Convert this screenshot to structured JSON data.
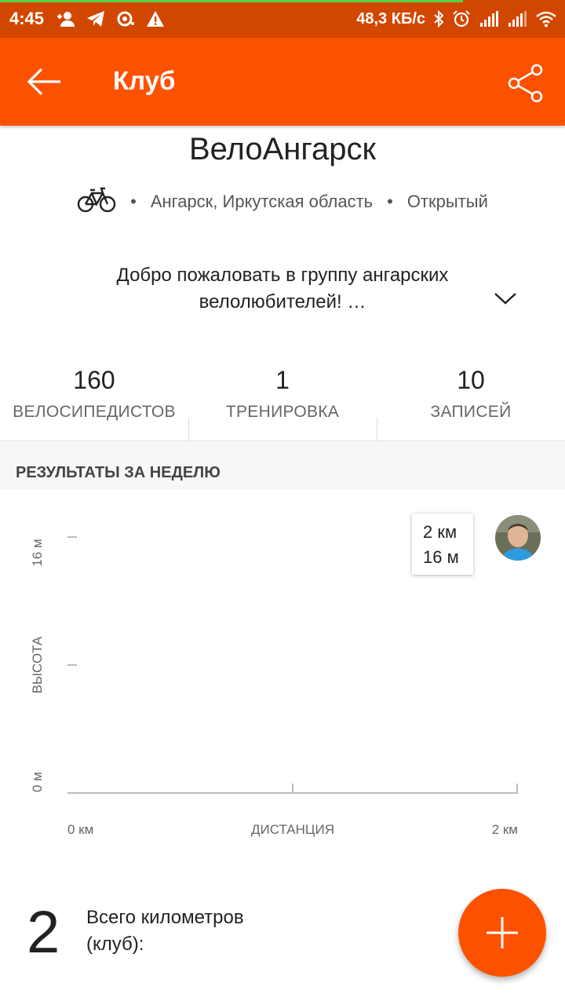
{
  "status_bar": {
    "time": "4:45",
    "network_speed": "48,3 КБ/с",
    "left_icons": [
      "add-contact-icon",
      "telegram-icon",
      "sync-icon",
      "warning-icon"
    ],
    "right_icons": [
      "bluetooth-icon",
      "alarm-icon",
      "signal-icon",
      "signal-icon",
      "wifi-icon"
    ]
  },
  "app_bar": {
    "title": "Клуб",
    "back_icon": "arrow-left-icon",
    "share_icon": "share-icon",
    "color": "#fc5200"
  },
  "club": {
    "name": "ВелоАнгарск",
    "sport_icon": "bicycle-icon",
    "location": "Ангарск, Иркутская область",
    "privacy": "Открытый",
    "description_line1": "Добро пожаловать в группу ангарских",
    "description_line2": "велолюбителей!  …"
  },
  "stats": [
    {
      "value": "160",
      "label": "ВЕЛОСИПЕДИСТОВ"
    },
    {
      "value": "1",
      "label": "ТРЕНИРОВКА"
    },
    {
      "value": "10",
      "label": "ЗАПИСЕЙ"
    }
  ],
  "weekly": {
    "title": "РЕЗУЛЬТАТЫ ЗА НЕДЕЛЮ"
  },
  "chart_data": {
    "type": "scatter",
    "xlabel": "ДИСТАНЦИЯ",
    "ylabel": "ВЫСОТА",
    "x_tick_labels": [
      "0 км",
      "2 км"
    ],
    "y_tick_labels": [
      "0 м",
      "16 м"
    ],
    "xlim": [
      0,
      2
    ],
    "ylim": [
      0,
      16
    ],
    "points": [
      {
        "x": 2,
        "y": 16,
        "label_distance": "2 км",
        "label_elevation": "16 м"
      }
    ]
  },
  "totals": {
    "value": "2",
    "label": "Всего километров (клуб):"
  },
  "fab": {
    "icon": "plus-icon"
  }
}
